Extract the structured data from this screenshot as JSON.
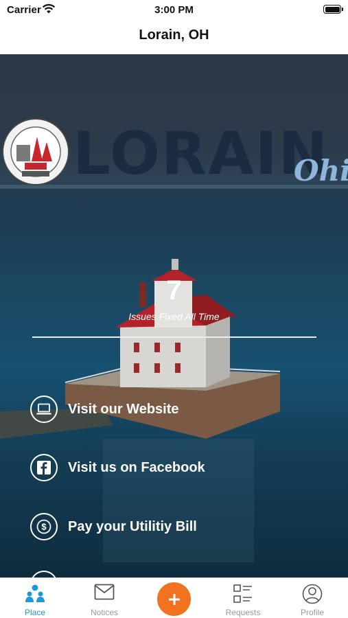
{
  "status_bar": {
    "carrier": "Carrier",
    "time": "3:00 PM"
  },
  "nav": {
    "title": "Lorain, OH"
  },
  "hero": {
    "logo_text": "LORAIN",
    "logo_script": "Ohio",
    "issues_fixed_count": "7",
    "issues_fixed_label": "Issues Fixed All Time"
  },
  "links": [
    {
      "label": "Visit our Website",
      "icon": "laptop-icon"
    },
    {
      "label": "Visit us on Facebook",
      "icon": "facebook-icon"
    },
    {
      "label": "Pay your Utilitiy Bill",
      "icon": "dollar-icon"
    }
  ],
  "tabs": [
    {
      "label": "Place",
      "icon": "people-icon",
      "active": true
    },
    {
      "label": "Notices",
      "icon": "envelope-icon",
      "active": false
    },
    {
      "label": "",
      "icon": "plus-icon",
      "active": false
    },
    {
      "label": "Requests",
      "icon": "checklist-icon",
      "active": false
    },
    {
      "label": "Profile",
      "icon": "person-icon",
      "active": false
    }
  ],
  "colors": {
    "accent": "#1b9ad6",
    "add_button": "#f1721f",
    "inactive": "#9a9a9a"
  }
}
